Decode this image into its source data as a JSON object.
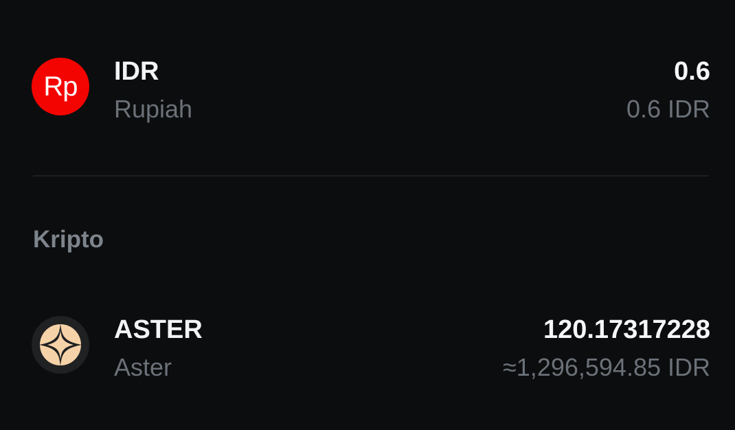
{
  "fiat": {
    "idr": {
      "icon_text": "Rp",
      "icon": "rupiah-coin-icon",
      "symbol": "IDR",
      "name": "Rupiah",
      "amount": "0.6",
      "value": "0.6 IDR"
    }
  },
  "crypto_section": {
    "title": "Kripto",
    "aster": {
      "icon": "aster-coin-icon",
      "symbol": "ASTER",
      "name": "Aster",
      "amount": "120.17317228",
      "value": "≈1,296,594.85 IDR"
    }
  },
  "colors": {
    "background": "#0c0d0f",
    "idr_icon": "#f40400",
    "aster_icon_fill": "#f6d2a8",
    "primary_text": "#f2f3f5",
    "secondary_text": "#6b7178"
  }
}
